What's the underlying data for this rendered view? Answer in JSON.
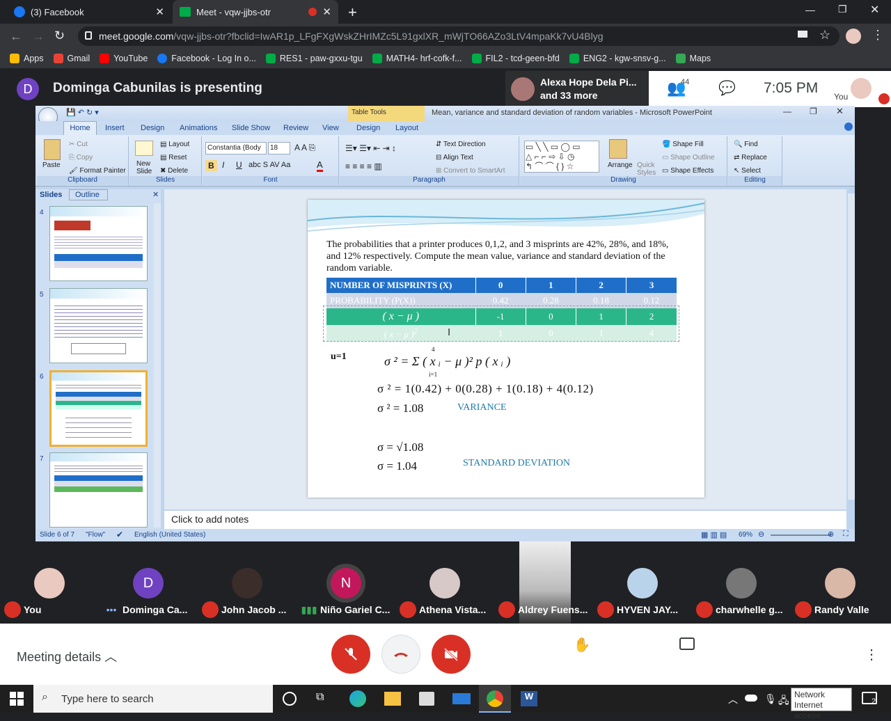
{
  "browser": {
    "tabs": [
      {
        "label": "(3) Facebook",
        "active": false
      },
      {
        "label": "Meet - vqw-jjbs-otr",
        "active": true
      }
    ],
    "url_host": "meet.google.com",
    "url_path": "/vqw-jjbs-otr?fbclid=IwAR1p_LFgFXgWskZHrIMZc5L91gxlXR_mWjTO66AZo3LtV4mpaKk7vU4Blyg",
    "bookmarks": [
      "Apps",
      "Gmail",
      "YouTube",
      "Facebook - Log In o...",
      "RES1 - paw-gxxu-tgu",
      "MATH4- hrf-cofk-f...",
      "FIL2 - tcd-geen-bfd",
      "ENG2 - kgw-snsv-g...",
      "Maps"
    ]
  },
  "meet": {
    "presenter_initial": "D",
    "presenting_title": "Dominga Cabunilas is presenting",
    "featured_name": "Alexa Hope Dela Pi...",
    "featured_more": "and 33 more",
    "people_count": "44",
    "time": "7:05 PM",
    "you_label": "You"
  },
  "ppt": {
    "contextual_tab": "Table Tools",
    "window_title": "Mean, variance and standard deviation of random variables - Microsoft PowerPoint",
    "tabs": [
      "Home",
      "Insert",
      "Design",
      "Animations",
      "Slide Show",
      "Review",
      "View",
      "Design",
      "Layout"
    ],
    "groups": [
      "Clipboard",
      "Slides",
      "Font",
      "Paragraph",
      "Drawing",
      "Editing"
    ],
    "clipboard": {
      "paste": "Paste",
      "cut": "Cut",
      "copy": "Copy",
      "format_painter": "Format Painter"
    },
    "slides_group": {
      "new_slide": "New Slide",
      "layout": "Layout",
      "reset": "Reset",
      "delete": "Delete"
    },
    "font": {
      "name": "Constantia (Body",
      "size": "18"
    },
    "paragraph": {
      "text_direction": "Text Direction",
      "align_text": "Align Text",
      "smartart": "Convert to SmartArt"
    },
    "drawing": {
      "arrange": "Arrange",
      "quick_styles": "Quick Styles",
      "shape_fill": "Shape Fill",
      "shape_outline": "Shape Outline",
      "shape_effects": "Shape Effects"
    },
    "editing": {
      "find": "Find",
      "replace": "Replace",
      "select": "Select"
    },
    "pane_tabs": [
      "Slides",
      "Outline"
    ],
    "thumb_numbers": [
      "4",
      "5",
      "6",
      "7"
    ],
    "notes_placeholder": "Click to add notes",
    "status": {
      "slide": "Slide 6 of 7",
      "theme": "\"Flow\"",
      "language": "English (United States)",
      "zoom": "69%"
    }
  },
  "slide": {
    "problem": "The probabilities that a printer produces 0,1,2, and 3 misprints are 42%, 28%, and 18%, and 12% respectively.  Compute the mean value, variance and standard deviation of the random variable.",
    "table_header": [
      "NUMBER OF MISPRINTS (X)",
      "0",
      "1",
      "2",
      "3"
    ],
    "table_prob": [
      "PROBABILITY (P(X))",
      "0.42",
      "0.28",
      "0.18",
      "0.12"
    ],
    "table_dev_label": "( x − μ )",
    "table_dev": [
      "-1",
      "0",
      "1",
      "2"
    ],
    "table_sq_label": "( x − μ )",
    "table_sq": [
      "1",
      "0",
      "1",
      "4"
    ],
    "mu_label": "u=1",
    "formula1": "σ ² = Σ ( x ᵢ − μ )² p ( x ᵢ )",
    "formula2": "σ ² = 1(0.42) + 0(0.28) + 1(0.18) + 4(0.12)",
    "formula3": "σ ² = 1.08",
    "variance_label": "VARIANCE",
    "formula4": "σ = √1.08",
    "formula5": "σ = 1.04",
    "sd_label": "STANDARD DEVIATION"
  },
  "participants": [
    {
      "name": "You",
      "initial": "",
      "muted": true
    },
    {
      "name": "Dominga Ca...",
      "initial": "D",
      "muted": false
    },
    {
      "name": "John Jacob ...",
      "initial": "",
      "muted": true
    },
    {
      "name": "Niño Gariel C...",
      "initial": "N",
      "muted": false
    },
    {
      "name": "Athena Vista...",
      "initial": "",
      "muted": true
    },
    {
      "name": "Aldrey Fuens...",
      "initial": "",
      "muted": true
    },
    {
      "name": "HYVEN JAY...",
      "initial": "",
      "muted": true
    },
    {
      "name": "charwhelle g...",
      "initial": "",
      "muted": true
    },
    {
      "name": "Randy Valle",
      "initial": "",
      "muted": true
    }
  ],
  "controls": {
    "meeting_details": "Meeting details",
    "raise_hand": "Raise hand",
    "captions": "Turn on captions",
    "presenting": "Dominga Cabunilas is presenting"
  },
  "taskbar": {
    "search_placeholder": "Type here to search",
    "network_line1": "Network",
    "network_line2": "Internet access",
    "notif_count": "2"
  }
}
